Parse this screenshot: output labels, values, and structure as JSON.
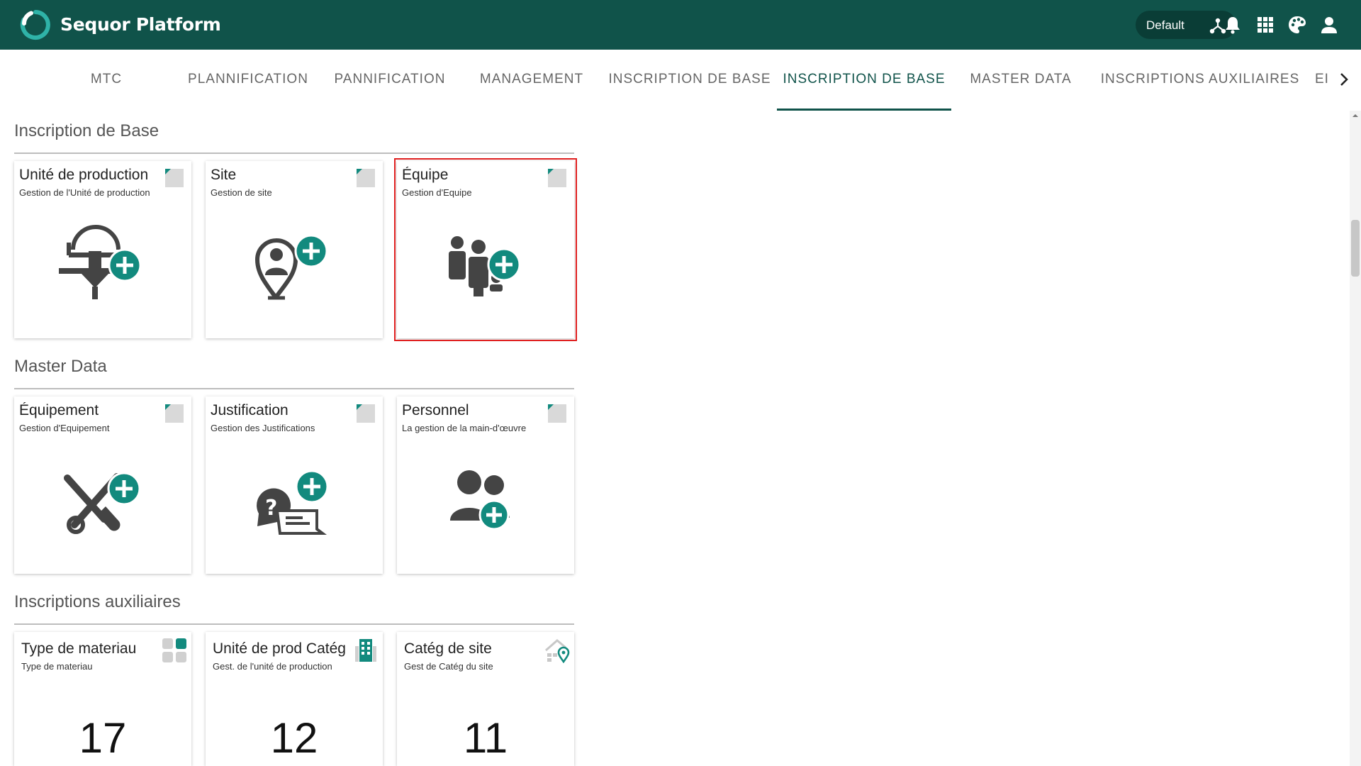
{
  "header": {
    "app_title": "Sequor Platform",
    "environment_label": "Default",
    "brand_color": "#10534a",
    "icons": [
      "network-icon",
      "bell-icon",
      "apps-grid-icon",
      "palette-icon",
      "user-icon"
    ]
  },
  "tabs": [
    {
      "label": "MTC",
      "active": false
    },
    {
      "label": "PLANNIFICATION",
      "active": false
    },
    {
      "label": "PANNIFICATION",
      "active": false
    },
    {
      "label": "MANAGEMENT",
      "active": false
    },
    {
      "label": "INSCRIPTION DE BASE",
      "active": false
    },
    {
      "label": "INSCRIPTION DE BASE",
      "active": true
    },
    {
      "label": "MASTER DATA",
      "active": false
    },
    {
      "label": "INSCRIPTIONS AUXILIAIRES",
      "active": false
    },
    {
      "label": "EI",
      "active": false
    }
  ],
  "sections": {
    "base": {
      "title": "Inscription de Base",
      "cards": [
        {
          "title": "Unité de production",
          "subtitle": "Gestion de l'Unité de production",
          "icon": "production-unit-add-icon"
        },
        {
          "title": "Site",
          "subtitle": "Gestion de site",
          "icon": "site-location-add-icon"
        },
        {
          "title": "Équipe",
          "subtitle": "Gestion d'Equipe",
          "icon": "team-add-icon",
          "selected": true
        }
      ]
    },
    "master": {
      "title": "Master Data",
      "cards": [
        {
          "title": "Équipement",
          "subtitle": "Gestion d'Equipement",
          "icon": "tools-add-icon"
        },
        {
          "title": "Justification",
          "subtitle": "Gestion des Justifications",
          "icon": "justification-chat-add-icon"
        },
        {
          "title": "Personnel",
          "subtitle": "La gestion de la main-d'œuvre",
          "icon": "people-add-icon"
        }
      ]
    },
    "aux": {
      "title": "Inscriptions auxiliaires",
      "cards": [
        {
          "title": "Type de materiau",
          "subtitle": "Type de materiau",
          "count": "17",
          "icon": "material-blocks-icon"
        },
        {
          "title": "Unité de prod Catég",
          "subtitle": "Gest. de l'unité de production",
          "count": "12",
          "icon": "building-icon"
        },
        {
          "title": "Catég de site",
          "subtitle": "Gest de Catég du site",
          "count": "11",
          "icon": "home-location-icon"
        }
      ]
    }
  }
}
